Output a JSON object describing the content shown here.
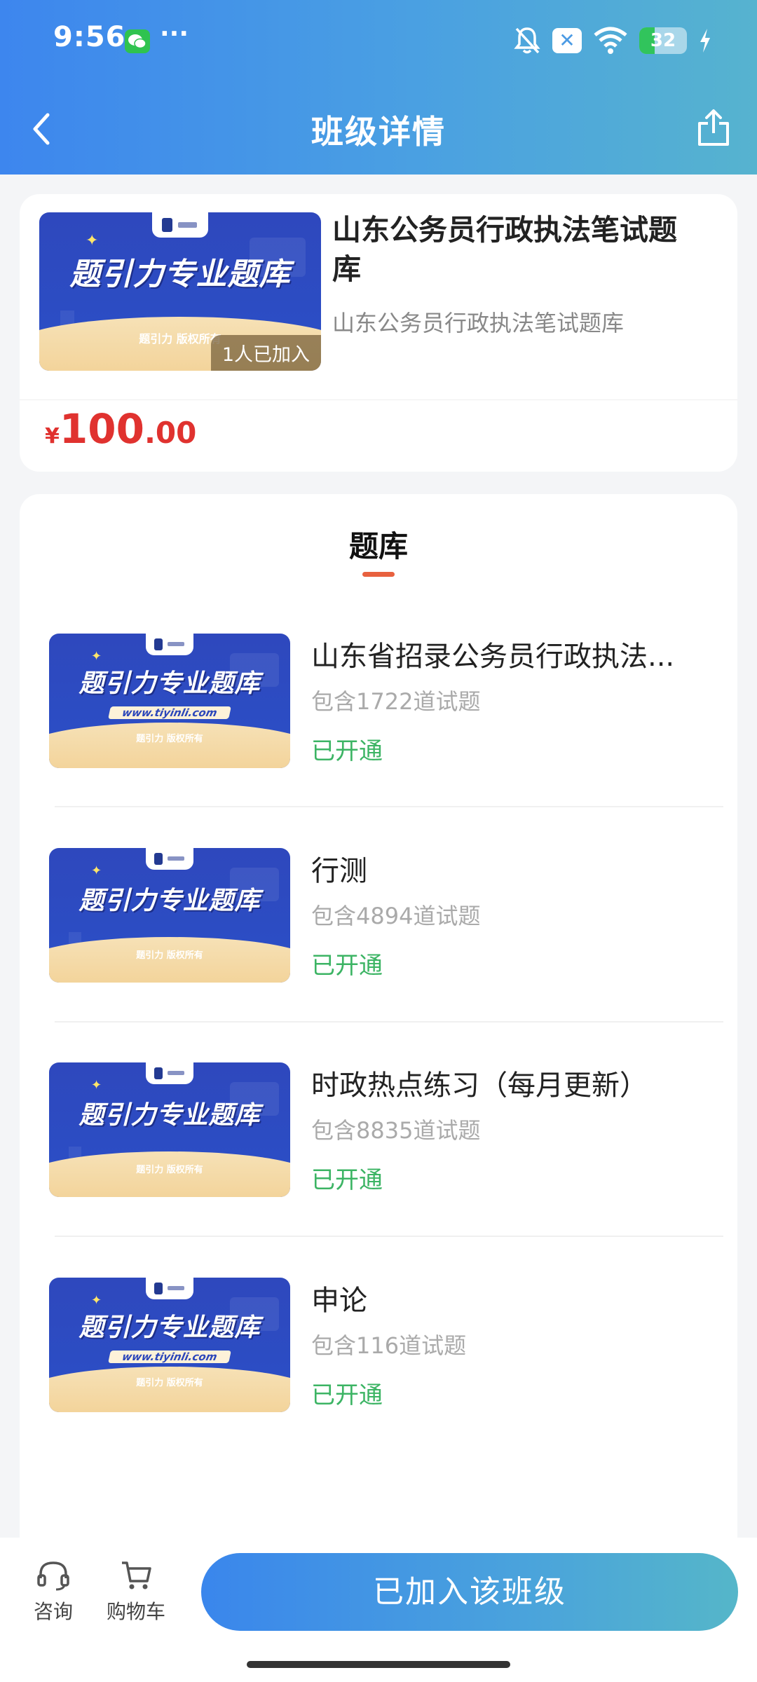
{
  "status_bar": {
    "time": "9:56",
    "more": "···",
    "battery": "32",
    "icons": [
      "wechat-icon",
      "bell-muted-icon",
      "x-badge-icon",
      "wifi-icon",
      "battery-icon",
      "charging-icon"
    ]
  },
  "nav": {
    "title": "班级详情",
    "back_icon": "chevron-left-icon",
    "share_icon": "share-icon"
  },
  "class": {
    "cover": {
      "headline": "题引力专业题库",
      "copyright": "题引力 版权所有"
    },
    "joined_badge": "1人已加入",
    "title": "山东公务员行政执法笔试题库",
    "subtitle": "山东公务员行政执法笔试题库",
    "price": {
      "symbol": "¥",
      "integer": "100",
      "decimal": ".00"
    }
  },
  "section": {
    "title": "题库"
  },
  "banks": [
    {
      "title": "山东省招录公务员行政执法...",
      "count": "包含1722道试题",
      "status": "已开通",
      "cover_headline": "题引力专业题库",
      "cover_url": "www.tiyinli.com",
      "cover_copyright": "题引力 版权所有"
    },
    {
      "title": "行测",
      "count": "包含4894道试题",
      "status": "已开通",
      "cover_headline": "题引力专业题库",
      "cover_url": "",
      "cover_copyright": "题引力 版权所有"
    },
    {
      "title": "时政热点练习（每月更新）",
      "count": "包含8835道试题",
      "status": "已开通",
      "cover_headline": "题引力专业题库",
      "cover_url": "",
      "cover_copyright": "题引力 版权所有"
    },
    {
      "title": "申论",
      "count": "包含116道试题",
      "status": "已开通",
      "cover_headline": "题引力专业题库",
      "cover_url": "www.tiyinli.com",
      "cover_copyright": "题引力 版权所有"
    }
  ],
  "bottom_bar": {
    "consult": "咨询",
    "cart": "购物车",
    "join_button": "已加入该班级"
  },
  "colors": {
    "header_start": "#3d86ee",
    "header_end": "#56b3cf",
    "price": "#e0322f",
    "status_green": "#3cb464",
    "tab_underline": "#e8613f",
    "cover_blue": "#2e48bd"
  }
}
